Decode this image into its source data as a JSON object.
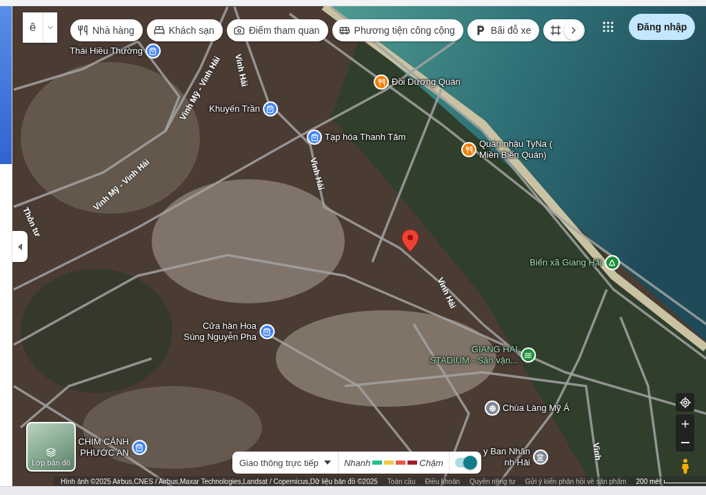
{
  "input_tool": {
    "label": "ê"
  },
  "chips": [
    {
      "label": "Nhà hàng",
      "kind": "restaurant"
    },
    {
      "label": "Khách sạn",
      "kind": "hotel"
    },
    {
      "label": "Điểm tham quan",
      "kind": "attraction"
    },
    {
      "label": "Phương tiện công cộng",
      "kind": "transit"
    },
    {
      "label": "Bãi đỗ xe",
      "kind": "parking"
    }
  ],
  "login_button": "Đăng nhập",
  "roads": [
    "Vinh Hải",
    "Vinh Mỹ - Vinh Hải",
    "Vinh Mỹ - Vinh Hải",
    "Vinh Hải",
    "Thôn tư",
    "Vinh Hải",
    "Vinh"
  ],
  "places": [
    {
      "lines": [
        "Thái Hiều Thường"
      ],
      "kind": "shop"
    },
    {
      "lines": [
        "Đồi Dương Quán"
      ],
      "kind": "restaurant"
    },
    {
      "lines": [
        "Khuyến Trần"
      ],
      "kind": "shop"
    },
    {
      "lines": [
        "Tạp hóa Thanh Tâm"
      ],
      "kind": "shop"
    },
    {
      "lines": [
        "Quán nhậu TyNa (",
        "Miền Biển Quán)"
      ],
      "kind": "restaurant"
    },
    {
      "lines": [
        "Biển xã Giang Hải"
      ],
      "kind": "park"
    },
    {
      "lines": [
        "Cửa hàn Hoa",
        "Súng Nguyễn Pha"
      ],
      "kind": "shop"
    },
    {
      "lines": [
        "GIANG HAI",
        "STADIUM - Sân vận..."
      ],
      "kind": "stadium"
    },
    {
      "lines": [
        "Chùa Làng Mỹ Á"
      ],
      "kind": "temple"
    },
    {
      "lines": [
        "CHIM CẢNH",
        "PHƯỚC AN"
      ],
      "kind": "shop"
    },
    {
      "lines": [
        "y Ban Nhân",
        "nh Hải"
      ],
      "kind": "government"
    }
  ],
  "layers_button": "Lớp bản đồ",
  "traffic": {
    "label": "Giao thông trực tiếp",
    "fast": "Nhanh",
    "slow": "Chậm",
    "on": true,
    "legend": [
      {
        "color": "#1ec48a"
      },
      {
        "color": "#f2c94c"
      },
      {
        "color": "#e8574a"
      },
      {
        "color": "#a51d2a"
      }
    ]
  },
  "footer": {
    "attribution": "Hình ảnh ©2025 Airbus,CNES / Airbus,Maxar Technologies,Landsat / Copernicus,Dữ liệu bản đồ ©2025",
    "links": [
      "Toàn cầu",
      "Điều khoản",
      "Quyền riêng tư",
      "Gửi ý kiến phản hồi về sản phẩm"
    ],
    "scale": "200 mét"
  }
}
